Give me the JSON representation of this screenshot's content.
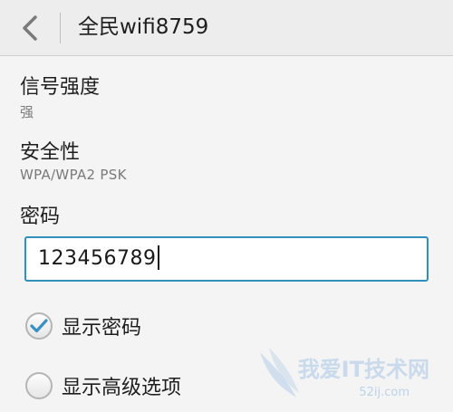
{
  "header": {
    "title": "全民wifi8759",
    "back_icon": "chevron-left-icon"
  },
  "signal": {
    "label": "信号强度",
    "value": "强"
  },
  "security": {
    "label": "安全性",
    "value": "WPA/WPA2 PSK"
  },
  "password": {
    "label": "密码",
    "value": "123456789"
  },
  "options": {
    "show_password": {
      "label": "显示密码",
      "checked": true
    },
    "advanced": {
      "label": "显示高级选项",
      "checked": false
    }
  },
  "watermark": {
    "text": "我爱IT技术网",
    "url": "52ij.com"
  },
  "colors": {
    "accent": "#2f8fbf",
    "check": "#3a8fc4"
  }
}
